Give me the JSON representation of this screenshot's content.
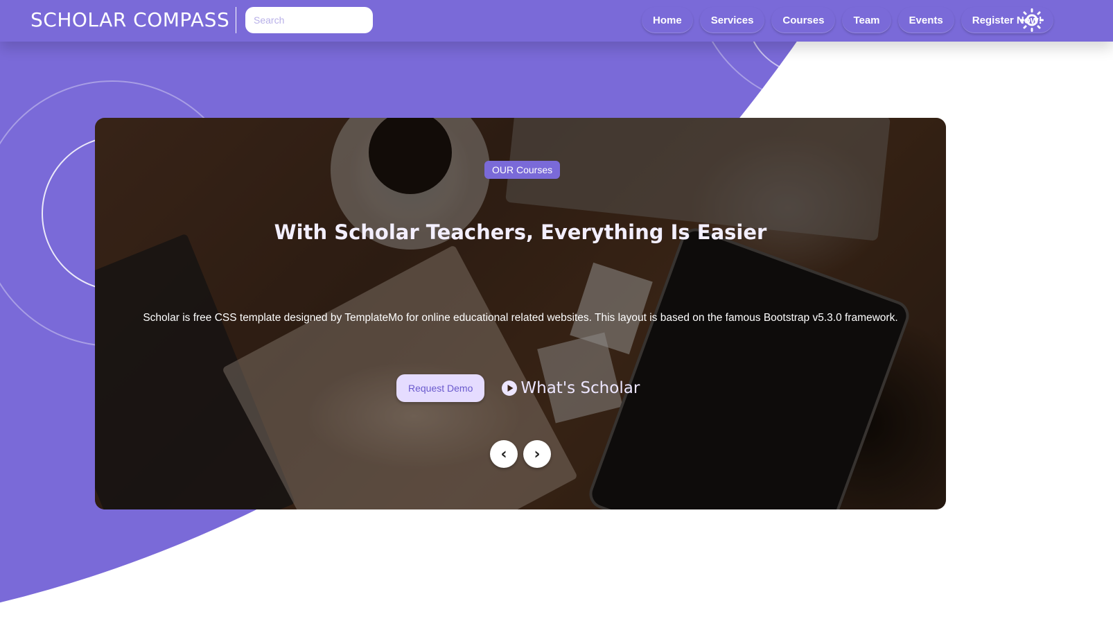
{
  "header": {
    "logo": "SCHOLAR COMPASS",
    "search_placeholder": "Search",
    "nav": [
      {
        "label": "Home"
      },
      {
        "label": "Services"
      },
      {
        "label": "Courses"
      },
      {
        "label": "Team"
      },
      {
        "label": "Events"
      },
      {
        "label": "Register Now!"
      }
    ],
    "theme_icon": "sun-icon"
  },
  "hero": {
    "badge": "OUR Courses",
    "title": "With Scholar Teachers, Everything Is Easier",
    "description": "Scholar is free CSS template designed by TemplateMo for online educational related websites. This layout is based on the famous Bootstrap v5.3.0 framework.",
    "primary_button": "Request Demo",
    "video_link": "What's Scholar",
    "prev_arrow": "‹",
    "next_arrow": "›"
  },
  "colors": {
    "brand": "#7a6ad8",
    "button_light": "#e5dcff",
    "white": "#ffffff"
  }
}
